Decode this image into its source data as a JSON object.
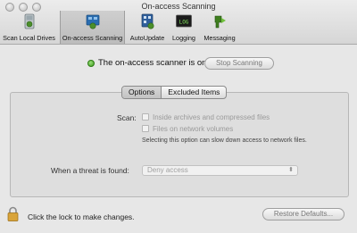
{
  "window": {
    "title": "On-access Scanning"
  },
  "toolbar": {
    "items": [
      {
        "label": "Scan Local Drives",
        "icon": "drive-scan-icon"
      },
      {
        "label": "On-access Scanning",
        "icon": "on-access-icon",
        "selected": true
      },
      {
        "label": "AutoUpdate",
        "icon": "autoupdate-icon"
      },
      {
        "label": "Logging",
        "icon": "log-icon",
        "icon_text": "LOG"
      },
      {
        "label": "Messaging",
        "icon": "messaging-icon"
      }
    ]
  },
  "status": {
    "text": "The on-access scanner is on",
    "indicator_color": "#3c9a1b",
    "stop_button": "Stop Scanning"
  },
  "tabs": [
    "Options",
    "Excluded Items"
  ],
  "options": {
    "scan_label": "Scan:",
    "inside_archives": "Inside archives and compressed files",
    "network_volumes": "Files on network volumes",
    "note": "Selecting this option can slow down access to network files.",
    "threat_label": "When a threat is found:",
    "threat_value": "Deny access"
  },
  "footer": {
    "lock_text": "Click the lock to make changes.",
    "restore_button": "Restore Defaults..."
  }
}
